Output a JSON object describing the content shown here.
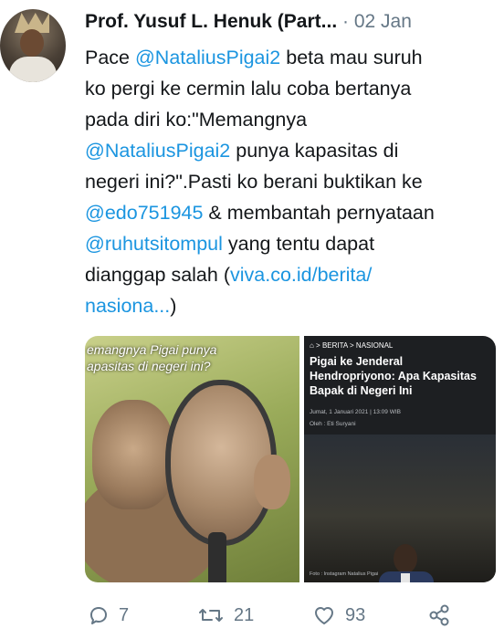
{
  "tweet": {
    "author_name": "Prof. Yusuf L. Henuk (Part...",
    "date": "· 02 Jan",
    "text_lines": [
      [
        {
          "t": "Pace ",
          "link": false
        },
        {
          "t": "@NataliusPigai2",
          "link": true
        },
        {
          "t": " beta mau suruh",
          "link": false
        }
      ],
      [
        {
          "t": "ko pergi ke cermin lalu coba bertanya",
          "link": false
        }
      ],
      [
        {
          "t": "pada diri ko:\"Memangnya",
          "link": false
        }
      ],
      [
        {
          "t": "@NataliusPigai2",
          "link": true
        },
        {
          "t": " punya kapasitas di",
          "link": false
        }
      ],
      [
        {
          "t": "negeri ini?\".Pasti ko berani buktikan ke",
          "link": false
        }
      ],
      [
        {
          "t": "@edo751945",
          "link": true
        },
        {
          "t": " & membantah pernyataan",
          "link": false
        }
      ],
      [
        {
          "t": "@ruhutsitompul",
          "link": true
        },
        {
          "t": " yang tentu dapat",
          "link": false
        }
      ],
      [
        {
          "t": "dianggap salah (",
          "link": false
        },
        {
          "t": "viva.co.id/berita/",
          "link": true
        }
      ],
      [
        {
          "t": "nasiona...",
          "link": true
        },
        {
          "t": ")",
          "link": false
        }
      ]
    ]
  },
  "media": {
    "left_caption_line1": "emangnya Pigai punya",
    "left_caption_line2": "apasitas di negeri ini?",
    "news_breadcrumb": "⌂ > BERITA > NASIONAL",
    "news_title_line1": "Pigai ke Jenderal",
    "news_title_line2": "Hendropriyono: Apa Kapasitas",
    "news_title_line3": "Bapak di Negeri Ini",
    "news_meta": "Jumat, 1 Januari 2021 | 13:09 WIB",
    "news_author": "Oleh : Eti Suryani",
    "news_credit": "Foto : Instagram Natalius Pigai"
  },
  "actions": {
    "reply_count": "7",
    "retweet_count": "21",
    "like_count": "93"
  },
  "colors": {
    "link": "#1b95e0",
    "muted": "#657786",
    "text": "#14171a"
  },
  "icons": [
    "reply-icon",
    "retweet-icon",
    "like-icon",
    "share-icon"
  ]
}
